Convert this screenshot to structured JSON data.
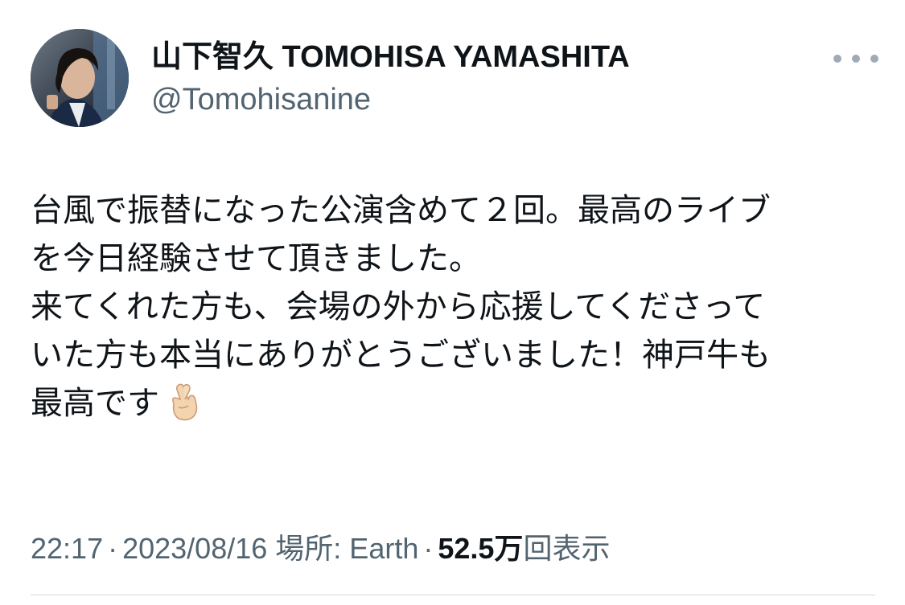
{
  "author": {
    "display_name": "山下智久 TOMOHISA YAMASHITA",
    "handle": "@Tomohisanine",
    "avatar": "profile-photo"
  },
  "more_icon": "more-horizontal-icon",
  "tweet": {
    "lines": [
      "台風で振替になった公演含めて２回。最高のライブ",
      "を今日経験させて頂きました。",
      "来てくれた方も、会場の外から応援してくださって",
      "いた方も本当にありがとうございました！神戸牛も",
      "最高です"
    ],
    "emoji": "crossed-fingers-icon"
  },
  "meta": {
    "time": "22:17",
    "separator": "·",
    "date": "2023/08/16",
    "location_label": "場所: Earth",
    "views_count": "52.5万",
    "views_label": "回表示"
  },
  "colors": {
    "text": "#0f1419",
    "secondary": "#536471",
    "divider": "#cfd9de"
  }
}
